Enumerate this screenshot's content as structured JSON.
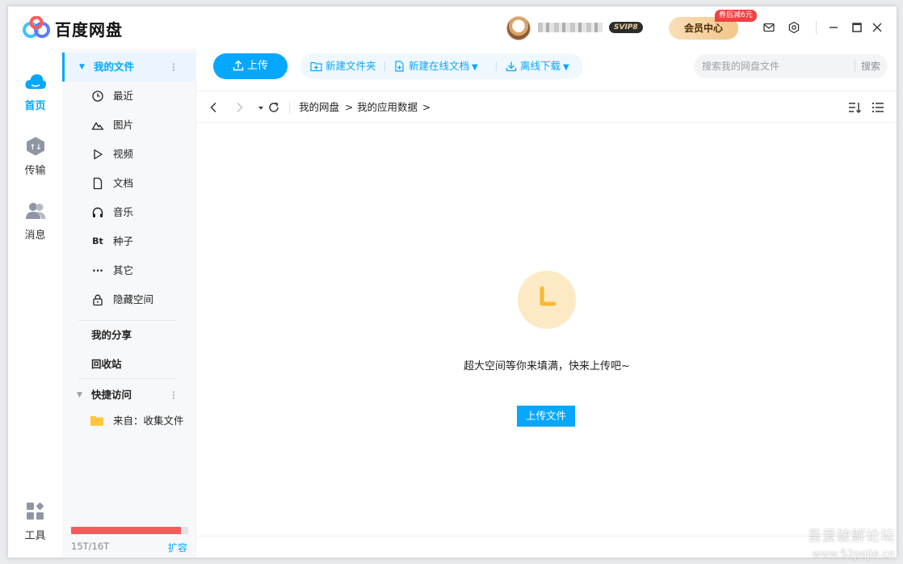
{
  "app": {
    "title": "百度网盘",
    "vip_level": "SVIP8",
    "vip_center": "会员中心",
    "coupon": "券后减6元"
  },
  "leftnav": [
    {
      "label": "首页",
      "icon": "cloud-icon"
    },
    {
      "label": "传输",
      "icon": "transfer-icon"
    },
    {
      "label": "消息",
      "icon": "users-icon"
    },
    {
      "label": "工具",
      "icon": "tools-icon"
    }
  ],
  "sidebar": {
    "my_files": "我的文件",
    "sub": [
      {
        "label": "最近",
        "icon": "clock-icon"
      },
      {
        "label": "图片",
        "icon": "image-icon"
      },
      {
        "label": "视频",
        "icon": "play-icon"
      },
      {
        "label": "文档",
        "icon": "doc-icon"
      },
      {
        "label": "音乐",
        "icon": "headphone-icon"
      },
      {
        "label": "种子",
        "icon": "bt-icon",
        "glyph": "Bt"
      },
      {
        "label": "其它",
        "icon": "more-icon",
        "glyph": "···"
      },
      {
        "label": "隐藏空间",
        "icon": "lock-icon"
      }
    ],
    "my_share": "我的分享",
    "recycle": "回收站",
    "quick_access": "快捷访问",
    "quick_items": [
      {
        "label": "来自：收集文件",
        "icon": "folder-icon"
      }
    ],
    "storage": {
      "used_text": "15T/16T",
      "fraction": 0.9375,
      "expand": "扩容"
    }
  },
  "toolbar": {
    "upload": "上传",
    "new_folder": "新建文件夹",
    "new_online_doc": "新建在线文档",
    "offline_download": "离线下载",
    "search_placeholder": "搜索我的网盘文件",
    "search_button": "搜索"
  },
  "breadcrumb": [
    "我的网盘",
    "我的应用数据"
  ],
  "empty": {
    "message": "超大空间等你来填满，快来上传吧~",
    "upload_button": "上传文件"
  },
  "watermark": {
    "text": "吾爱破解论坛",
    "url": "www.52pojie.cn"
  },
  "colors": {
    "accent": "#06a7ff",
    "storage_fill": "#f55a5a",
    "empty_icon_bg": "#fde9c4",
    "empty_icon_fg": "#f7b835"
  }
}
